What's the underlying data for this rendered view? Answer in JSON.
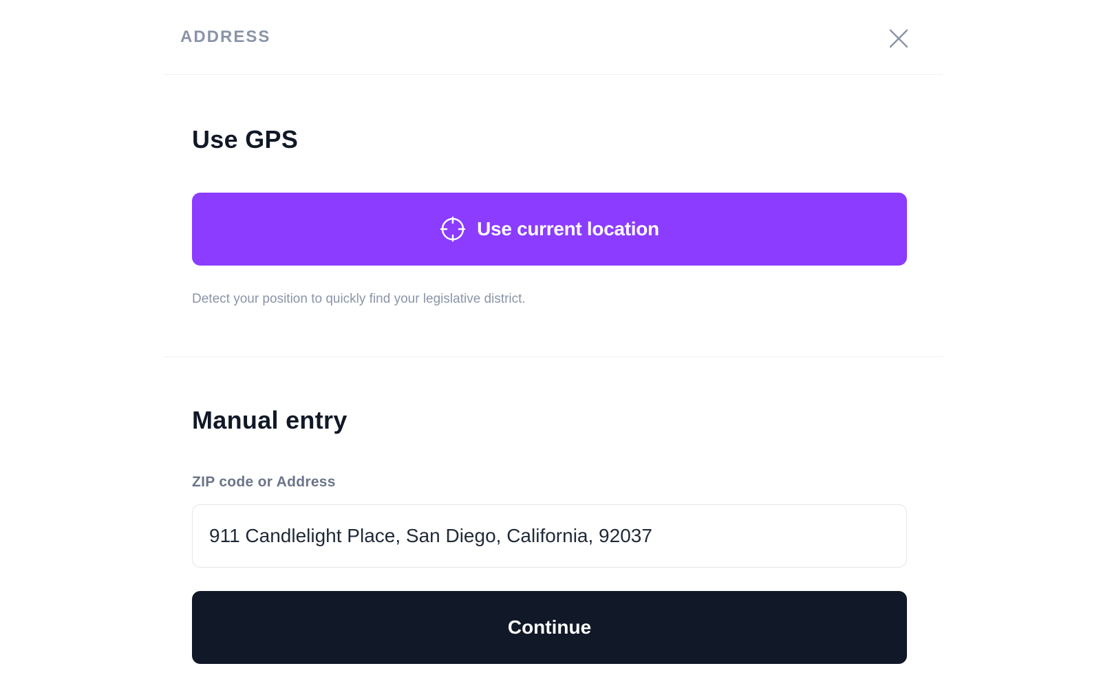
{
  "header": {
    "title": "ADDRESS",
    "close_icon": "close-icon"
  },
  "gps": {
    "title": "Use GPS",
    "button_label": "Use current location",
    "button_icon": "crosshair-icon",
    "help_text": "Detect your position to quickly find your legislative district."
  },
  "manual": {
    "title": "Manual entry",
    "field_label": "ZIP code or Address",
    "field_value": "911 Candlelight Place, San Diego, California, 92037",
    "continue_label": "Continue"
  },
  "colors": {
    "primary": "#8b3cff",
    "dark": "#111827",
    "muted": "#8a94a8",
    "border": "#e3e6ec"
  }
}
